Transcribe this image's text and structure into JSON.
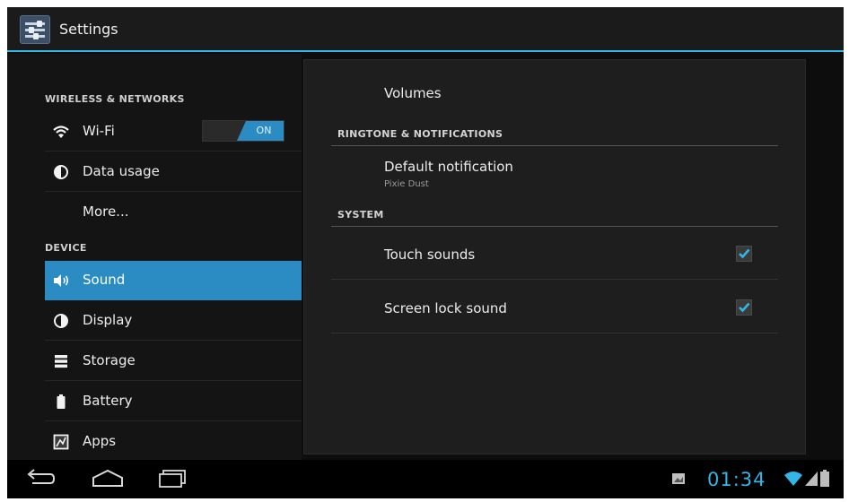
{
  "app": {
    "title": "Settings",
    "icon": "settings-sliders-icon"
  },
  "sidebar": {
    "sections": [
      {
        "label": "WIRELESS & NETWORKS"
      },
      {
        "label": "DEVICE"
      }
    ],
    "items": [
      {
        "label": "Wi-Fi",
        "icon": "wifi-icon",
        "toggle": "ON"
      },
      {
        "label": "Data usage",
        "icon": "data-usage-icon"
      },
      {
        "label": "More..."
      },
      {
        "label": "Sound",
        "icon": "speaker-icon",
        "selected": true
      },
      {
        "label": "Display",
        "icon": "display-icon"
      },
      {
        "label": "Storage",
        "icon": "storage-icon"
      },
      {
        "label": "Battery",
        "icon": "battery-icon"
      },
      {
        "label": "Apps",
        "icon": "apps-icon"
      }
    ]
  },
  "main": {
    "volumes": "Volumes",
    "ringtone_section": "RINGTONE & NOTIFICATIONS",
    "default_notification": {
      "title": "Default notification",
      "value": "Pixie Dust"
    },
    "system_section": "SYSTEM",
    "touch_sounds": {
      "label": "Touch sounds",
      "checked": true
    },
    "screen_lock_sound": {
      "label": "Screen lock sound",
      "checked": true
    }
  },
  "statusbar": {
    "time": "01:34"
  },
  "colors": {
    "accent": "#33b5e5",
    "selected": "#2b8cc4",
    "background": "#0d0d0d"
  }
}
